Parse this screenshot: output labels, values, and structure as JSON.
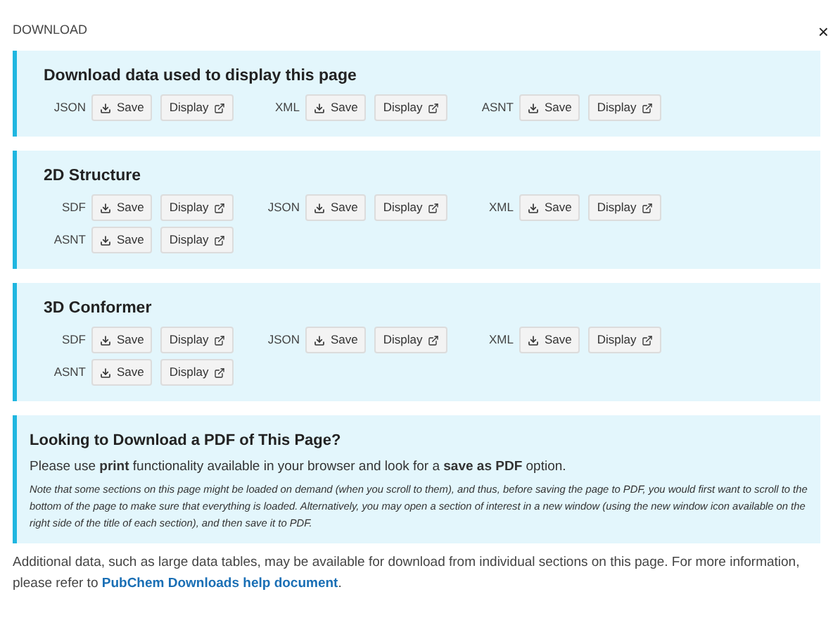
{
  "dialog": {
    "title": "DOWNLOAD",
    "close": "×"
  },
  "sections": [
    {
      "title": "Download data used to display this page",
      "formats": [
        {
          "label": "JSON",
          "save": "Save",
          "display": "Display"
        },
        {
          "label": "XML",
          "save": "Save",
          "display": "Display"
        },
        {
          "label": "ASNT",
          "save": "Save",
          "display": "Display"
        }
      ]
    },
    {
      "title": "2D Structure",
      "formats": [
        {
          "label": "SDF",
          "save": "Save",
          "display": "Display"
        },
        {
          "label": "JSON",
          "save": "Save",
          "display": "Display"
        },
        {
          "label": "XML",
          "save": "Save",
          "display": "Display"
        },
        {
          "label": "ASNT",
          "save": "Save",
          "display": "Display"
        }
      ]
    },
    {
      "title": "3D Conformer",
      "formats": [
        {
          "label": "SDF",
          "save": "Save",
          "display": "Display"
        },
        {
          "label": "JSON",
          "save": "Save",
          "display": "Display"
        },
        {
          "label": "XML",
          "save": "Save",
          "display": "Display"
        },
        {
          "label": "ASNT",
          "save": "Save",
          "display": "Display"
        }
      ]
    }
  ],
  "pdf_box": {
    "title": "Looking to Download a PDF of This Page?",
    "text": "Please use **print** functionality available in your browser and look for a **save as PDF** option.",
    "note": "Note that some sections on this page might be loaded on demand (when you scroll to them), and thus, before saving the page to PDF, you would first want to scroll to the bottom of the page to make sure that everything is loaded. Alternatively, you may open a section of interest in a new window (using the new window icon available on the right side of the title of each section), and then save it to PDF."
  },
  "footer": {
    "text": "Additional data, such as large data tables, may be available for download from individual sections on this page. For more information, please refer to",
    "link": "PubChem Downloads help document",
    "end": "."
  }
}
